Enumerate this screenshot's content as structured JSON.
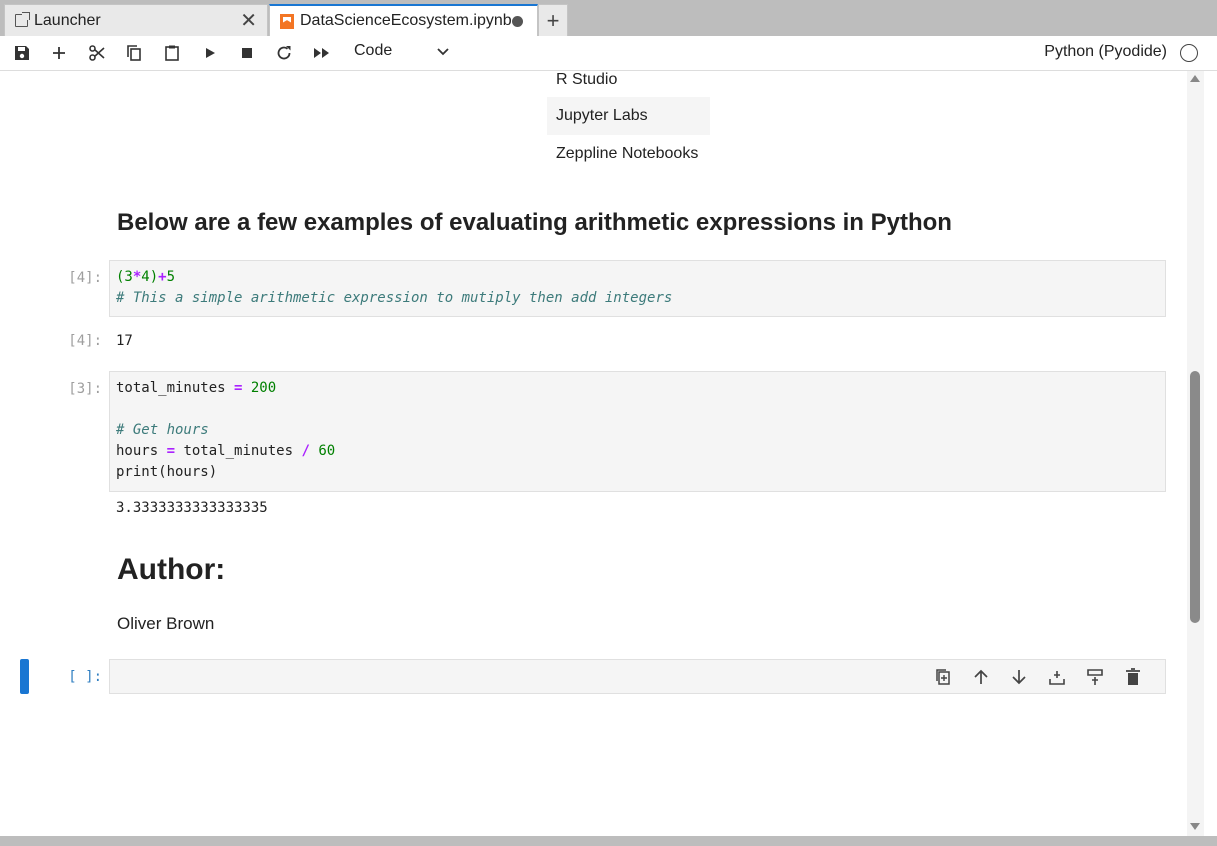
{
  "tabs": [
    {
      "label": "Launcher",
      "close": "✕"
    },
    {
      "label": "DataScienceEcosystem.ipynb"
    }
  ],
  "tab_add": "+",
  "toolbar": {
    "cell_type": "Code",
    "kernel": "Python (Pyodide)"
  },
  "markdown": {
    "list_items": [
      "R Studio",
      "Jupyter Labs",
      "Zeppline Notebooks"
    ],
    "heading": "Below are a few examples of evaluating arithmetic expressions in Python",
    "author_heading": "Author:",
    "author_name": "Oliver Brown"
  },
  "cells": {
    "cell1": {
      "prompt": "[4]:",
      "lines": [
        [
          "(3",
          "*",
          "4)",
          "+",
          "5"
        ],
        "# This a simple arithmetic expression to mutiply then add integers"
      ],
      "output_prompt": "[4]:",
      "output": "17"
    },
    "cell2": {
      "prompt": "[3]:",
      "line1": [
        "total_minutes ",
        "=",
        " 200"
      ],
      "comment": "# Get hours",
      "line4": [
        "hours ",
        "=",
        " total_minutes ",
        "/",
        " 60"
      ],
      "line5": "print(hours)",
      "output": "3.3333333333333335"
    },
    "empty_cell": {
      "prompt": "[ ]:"
    }
  },
  "colors": {
    "accent": "#1976d2",
    "notebook_icon": "#f37524",
    "code_number": "#008000",
    "code_operator": "#aa22ff",
    "code_comment": "#3d7b7b"
  },
  "icons": {
    "toolbar": [
      "save-icon",
      "add-cell-icon",
      "cut-icon",
      "copy-icon",
      "paste-icon",
      "run-icon",
      "stop-icon",
      "restart-icon",
      "run-all-icon"
    ],
    "cell_toolbar": [
      "duplicate-icon",
      "move-up-icon",
      "move-down-icon",
      "insert-below-icon",
      "insert-above-icon",
      "delete-icon"
    ]
  }
}
